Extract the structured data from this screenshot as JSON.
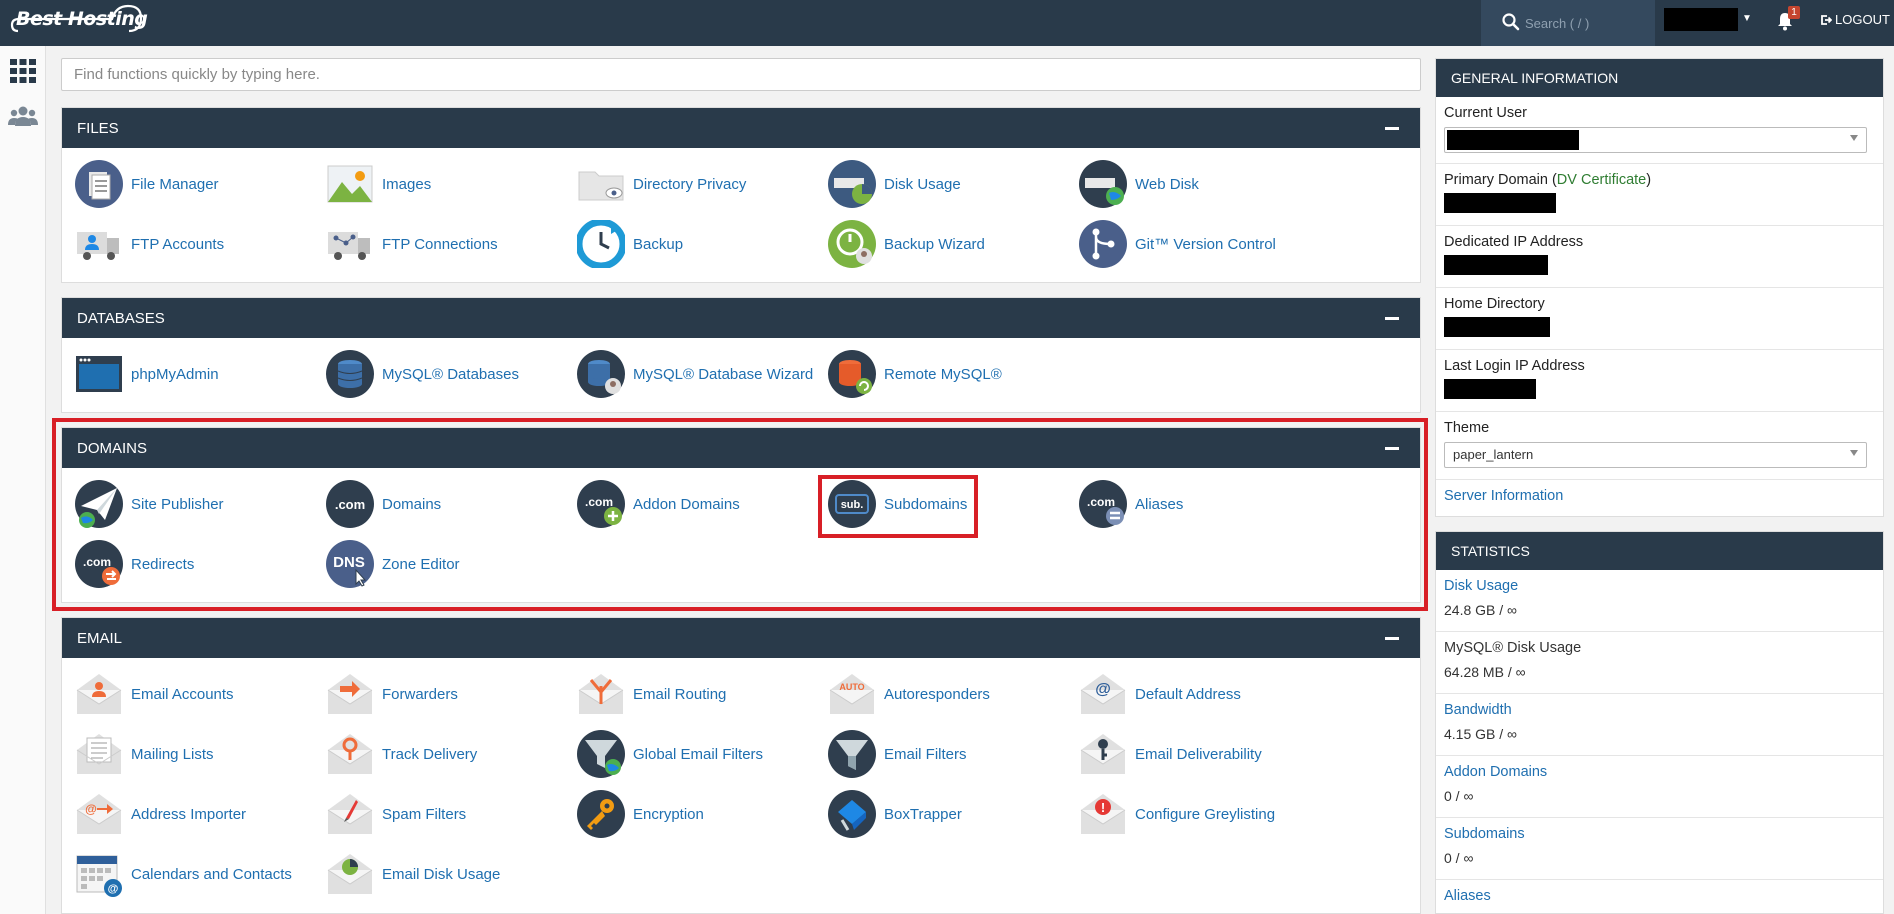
{
  "header": {
    "logo_text": "Best Hosting",
    "search_placeholder": "Search ( / )",
    "notification_count": "1",
    "logout_label": "LOGOUT"
  },
  "quick_search": {
    "placeholder": "Find functions quickly by typing here."
  },
  "sections": {
    "files": {
      "title": "FILES",
      "items": [
        "File Manager",
        "Images",
        "Directory Privacy",
        "Disk Usage",
        "Web Disk",
        "FTP Accounts",
        "FTP Connections",
        "Backup",
        "Backup Wizard",
        "Git™ Version Control"
      ]
    },
    "databases": {
      "title": "DATABASES",
      "items": [
        "phpMyAdmin",
        "MySQL® Databases",
        "MySQL® Database Wizard",
        "Remote MySQL®"
      ]
    },
    "domains": {
      "title": "DOMAINS",
      "items": [
        "Site Publisher",
        "Domains",
        "Addon Domains",
        "Subdomains",
        "Aliases",
        "Redirects",
        "Zone Editor"
      ]
    },
    "email": {
      "title": "EMAIL",
      "items": [
        "Email Accounts",
        "Forwarders",
        "Email Routing",
        "Autoresponders",
        "Default Address",
        "Mailing Lists",
        "Track Delivery",
        "Global Email Filters",
        "Email Filters",
        "Email Deliverability",
        "Address Importer",
        "Spam Filters",
        "Encryption",
        "BoxTrapper",
        "Configure Greylisting",
        "Calendars and Contacts",
        "Email Disk Usage"
      ]
    }
  },
  "general_info": {
    "title": "GENERAL INFORMATION",
    "current_user_label": "Current User",
    "primary_domain_label": "Primary Domain",
    "primary_domain_open": " (",
    "primary_domain_cert": "DV Certificate",
    "primary_domain_close": ")",
    "dedicated_ip_label": "Dedicated IP Address",
    "home_dir_label": "Home Directory",
    "last_login_label": "Last Login IP Address",
    "theme_label": "Theme",
    "theme_value": "paper_lantern",
    "server_info_link": "Server Information"
  },
  "statistics": {
    "title": "STATISTICS",
    "rows": [
      {
        "label": "Disk Usage",
        "value": "24.8 GB / ∞"
      },
      {
        "label": "MySQL® Disk Usage",
        "value": "64.28 MB / ∞"
      },
      {
        "label": "Bandwidth",
        "value": "4.15 GB / ∞"
      },
      {
        "label": "Addon Domains",
        "value": "0 / ∞"
      },
      {
        "label": "Subdomains",
        "value": "0 / ∞"
      },
      {
        "label": "Aliases",
        "value": ""
      }
    ]
  },
  "icon_texts": {
    "com": ".com",
    "sub": "sub.",
    "dns": "DNS",
    "auto": "AUTO",
    "at": "@",
    "excl": "!"
  },
  "colors": {
    "header_bg": "#293a4a",
    "link": "#1f6fb0",
    "highlight": "#d81f26"
  }
}
